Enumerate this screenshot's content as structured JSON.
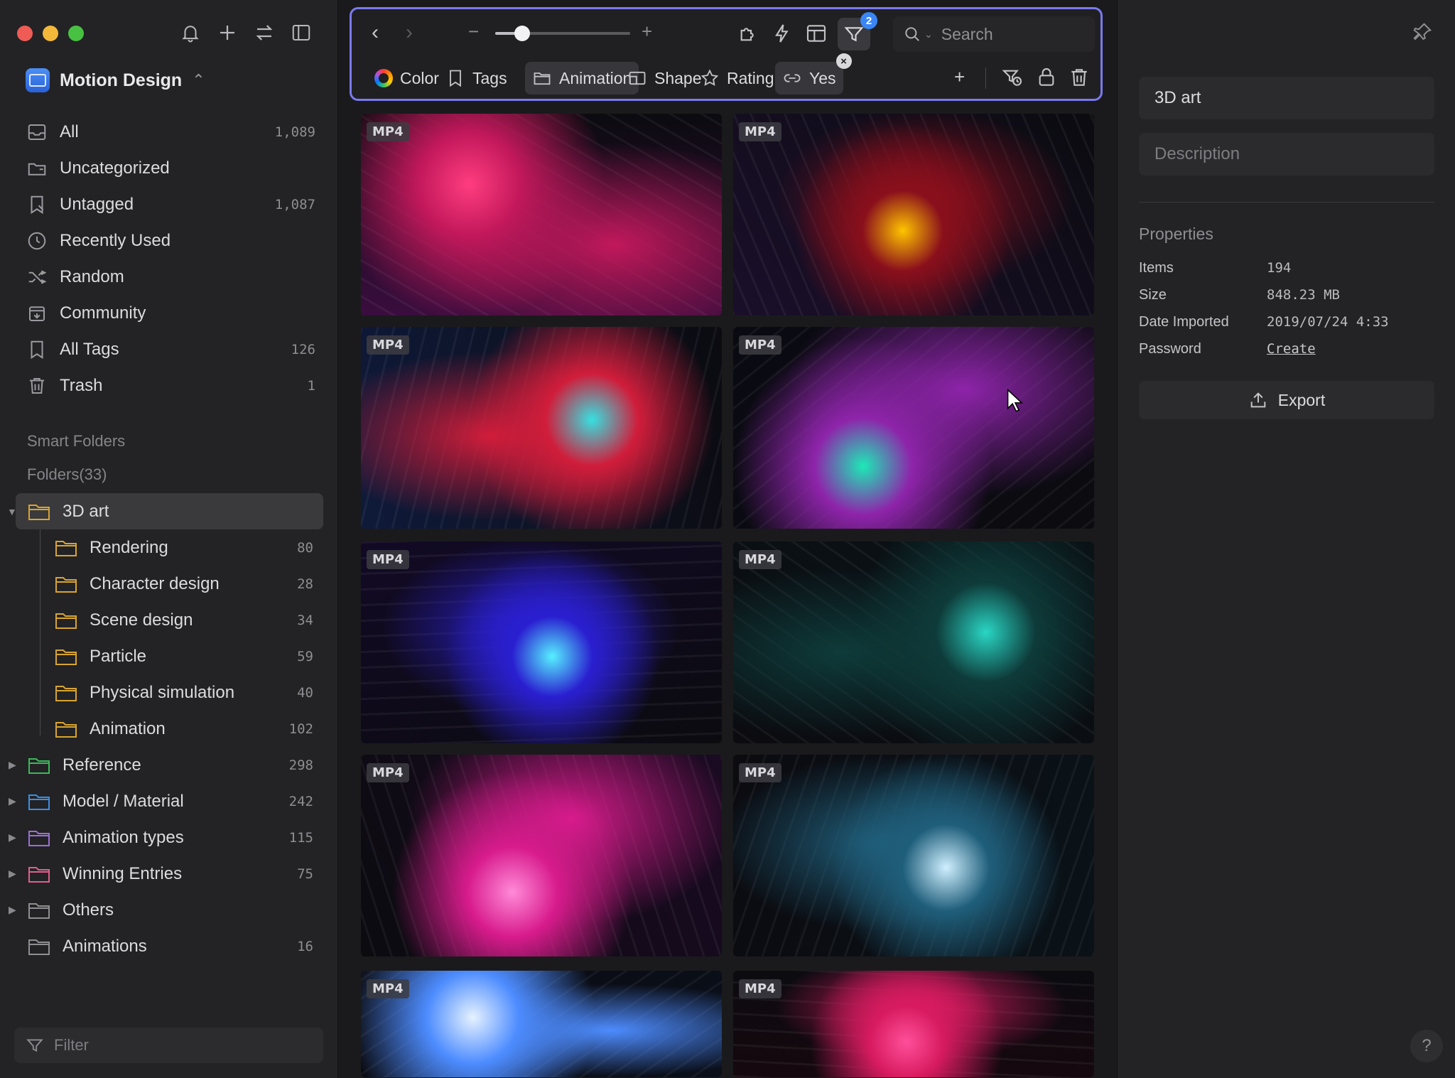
{
  "library": {
    "name": "Motion Design"
  },
  "nav": [
    {
      "label": "All",
      "count": "1,089",
      "icon": "inbox-icon"
    },
    {
      "label": "Uncategorized",
      "count": "",
      "icon": "uncategorized-folder-icon"
    },
    {
      "label": "Untagged",
      "count": "1,087",
      "icon": "untagged-icon"
    },
    {
      "label": "Recently Used",
      "count": "",
      "icon": "clock-icon"
    },
    {
      "label": "Random",
      "count": "",
      "icon": "shuffle-icon"
    },
    {
      "label": "Community",
      "count": "",
      "icon": "community-icon"
    },
    {
      "label": "All Tags",
      "count": "126",
      "icon": "bookmark-icon"
    },
    {
      "label": "Trash",
      "count": "1",
      "icon": "trash-icon"
    }
  ],
  "sections": {
    "smart_folders": "Smart Folders",
    "folders": "Folders(33)"
  },
  "folders": [
    {
      "label": "3D art",
      "count": "",
      "color": "#d8a431",
      "level": "root",
      "expanded": true,
      "selected": true
    },
    {
      "label": "Rendering",
      "count": "80",
      "color": "#d8a431",
      "level": "child"
    },
    {
      "label": "Character design",
      "count": "28",
      "color": "#d8a431",
      "level": "child"
    },
    {
      "label": "Scene design",
      "count": "34",
      "color": "#d8a431",
      "level": "child"
    },
    {
      "label": "Particle",
      "count": "59",
      "color": "#d8a431",
      "level": "child"
    },
    {
      "label": "Physical simulation",
      "count": "40",
      "color": "#d8a431",
      "level": "child"
    },
    {
      "label": "Animation",
      "count": "102",
      "color": "#d8a431",
      "level": "child"
    },
    {
      "label": "Reference",
      "count": "298",
      "color": "#3cb85a",
      "level": "root",
      "collapsed": true
    },
    {
      "label": "Model / Material",
      "count": "242",
      "color": "#3b8fe0",
      "level": "root",
      "collapsed": true
    },
    {
      "label": "Animation types",
      "count": "115",
      "color": "#9b6fd6",
      "level": "root",
      "collapsed": true
    },
    {
      "label": "Winning Entries",
      "count": "75",
      "color": "#e0608a",
      "level": "root",
      "collapsed": true
    },
    {
      "label": "Others",
      "count": "",
      "color": "#8e8e93",
      "level": "root",
      "collapsed": true
    },
    {
      "label": "Animations",
      "count": "16",
      "color": "#8e8e93",
      "level": "root",
      "leaf": true
    }
  ],
  "sidebar_filter": {
    "placeholder": "Filter"
  },
  "toolbar": {
    "zoom_level": 0.2,
    "filter_badge": "2",
    "search_placeholder": "Search",
    "chips": [
      {
        "label": "Color",
        "icon": "color-wheel-icon",
        "active": false
      },
      {
        "label": "Tags",
        "icon": "bookmark-icon",
        "active": false
      },
      {
        "label": "Animation",
        "icon": "folder-icon",
        "active": true
      },
      {
        "label": "Shape",
        "icon": "shape-icon",
        "active": false
      },
      {
        "label": "Rating",
        "icon": "star-icon",
        "active": false
      },
      {
        "label": "Yes",
        "icon": "link-icon",
        "active": true,
        "removable": true
      }
    ]
  },
  "grid": {
    "badge": "MP4",
    "items": [
      {
        "palette": [
          "#c2185b",
          "#3a0d3e",
          "#ff3d7f"
        ]
      },
      {
        "palette": [
          "#8a0f1c",
          "#1a0f2a",
          "#ffc400"
        ]
      },
      {
        "palette": [
          "#d01d3b",
          "#0f1a3a",
          "#37e0e0"
        ]
      },
      {
        "palette": [
          "#8e24aa",
          "#0a0a12",
          "#1de9b6"
        ]
      },
      {
        "palette": [
          "#2a1fd0",
          "#120a25",
          "#56f0ff"
        ]
      },
      {
        "palette": [
          "#0e3b3a",
          "#0a1216",
          "#29d6c4"
        ]
      },
      {
        "palette": [
          "#d81b8c",
          "#1a0a22",
          "#ff8ad8"
        ]
      },
      {
        "palette": [
          "#1f5e7a",
          "#0a1218",
          "#cfefff"
        ]
      },
      {
        "palette": [
          "#4d8cff",
          "#0a0f1a",
          "#e6f2ff"
        ]
      },
      {
        "palette": [
          "#d81b60",
          "#16080f",
          "#ff4f9a"
        ]
      }
    ]
  },
  "inspector": {
    "name_value": "3D art",
    "description_placeholder": "Description",
    "properties_title": "Properties",
    "properties": [
      {
        "key": "Items",
        "value": "194"
      },
      {
        "key": "Size",
        "value": "848.23 MB"
      },
      {
        "key": "Date Imported",
        "value": "2019/07/24 4:33"
      },
      {
        "key": "Password",
        "value": "Create",
        "link": true
      }
    ],
    "export_label": "Export",
    "help": "?"
  }
}
